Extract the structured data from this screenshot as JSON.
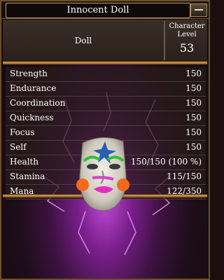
{
  "window": {
    "title": "Innocent Doll",
    "minimize_icon": "minimize-icon"
  },
  "header": {
    "name": "Doll",
    "level_label_line1": "Character",
    "level_label_line2": "Level",
    "level_value": "53"
  },
  "stats": [
    {
      "label": "Strength",
      "value": "150"
    },
    {
      "label": "Endurance",
      "value": "150"
    },
    {
      "label": "Coordination",
      "value": "150"
    },
    {
      "label": "Quickness",
      "value": "150"
    },
    {
      "label": "Focus",
      "value": "150"
    },
    {
      "label": "Self",
      "value": "150"
    },
    {
      "label": "Health",
      "value": "150/150 (100 %)"
    },
    {
      "label": "Stamina",
      "value": "115/150"
    },
    {
      "label": "Mana",
      "value": "122/350"
    }
  ],
  "portrait": {
    "icon": "clown-doll-mask-icon",
    "aura_color": "#c14ad6"
  }
}
